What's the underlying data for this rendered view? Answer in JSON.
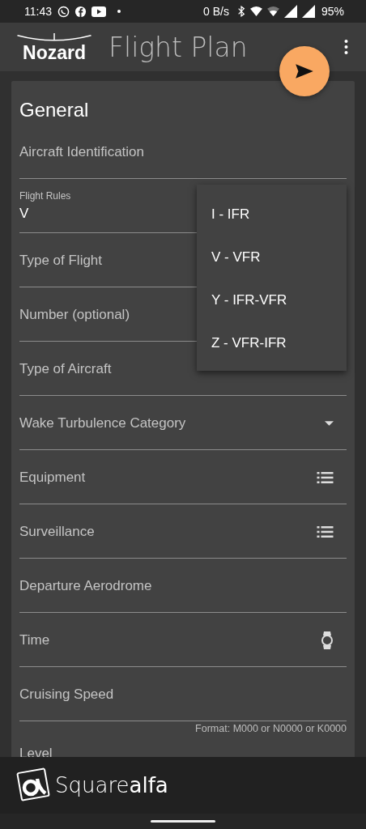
{
  "status_bar": {
    "time": "11:43",
    "net_speed": "0 B/s",
    "battery": "95%"
  },
  "app_bar": {
    "logo": "Nozard",
    "title": "Flight Plan"
  },
  "section": {
    "title": "General"
  },
  "fields": [
    {
      "kind": "text",
      "label": "Aircraft Identification"
    },
    {
      "kind": "select",
      "label": "Flight Rules",
      "value": "V",
      "expanded": true,
      "options": [
        "I - IFR",
        "V - VFR",
        "Y - IFR-VFR",
        "Z - VFR-IFR"
      ]
    },
    {
      "kind": "text",
      "label": "Type of Flight"
    },
    {
      "kind": "text",
      "label": "Number (optional)"
    },
    {
      "kind": "text",
      "label": "Type of Aircraft"
    },
    {
      "kind": "dropdown",
      "label": "Wake Turbulence Category"
    },
    {
      "kind": "list",
      "label": "Equipment"
    },
    {
      "kind": "list",
      "label": "Surveillance"
    },
    {
      "kind": "text",
      "label": "Departure Aerodrome"
    },
    {
      "kind": "time",
      "label": "Time"
    },
    {
      "kind": "text",
      "label": "Cruising Speed",
      "helper": "Format: M000 or N0000 or K0000"
    },
    {
      "kind": "text",
      "label": "Level"
    }
  ],
  "banner": {
    "brand": "Square**alfa**"
  }
}
